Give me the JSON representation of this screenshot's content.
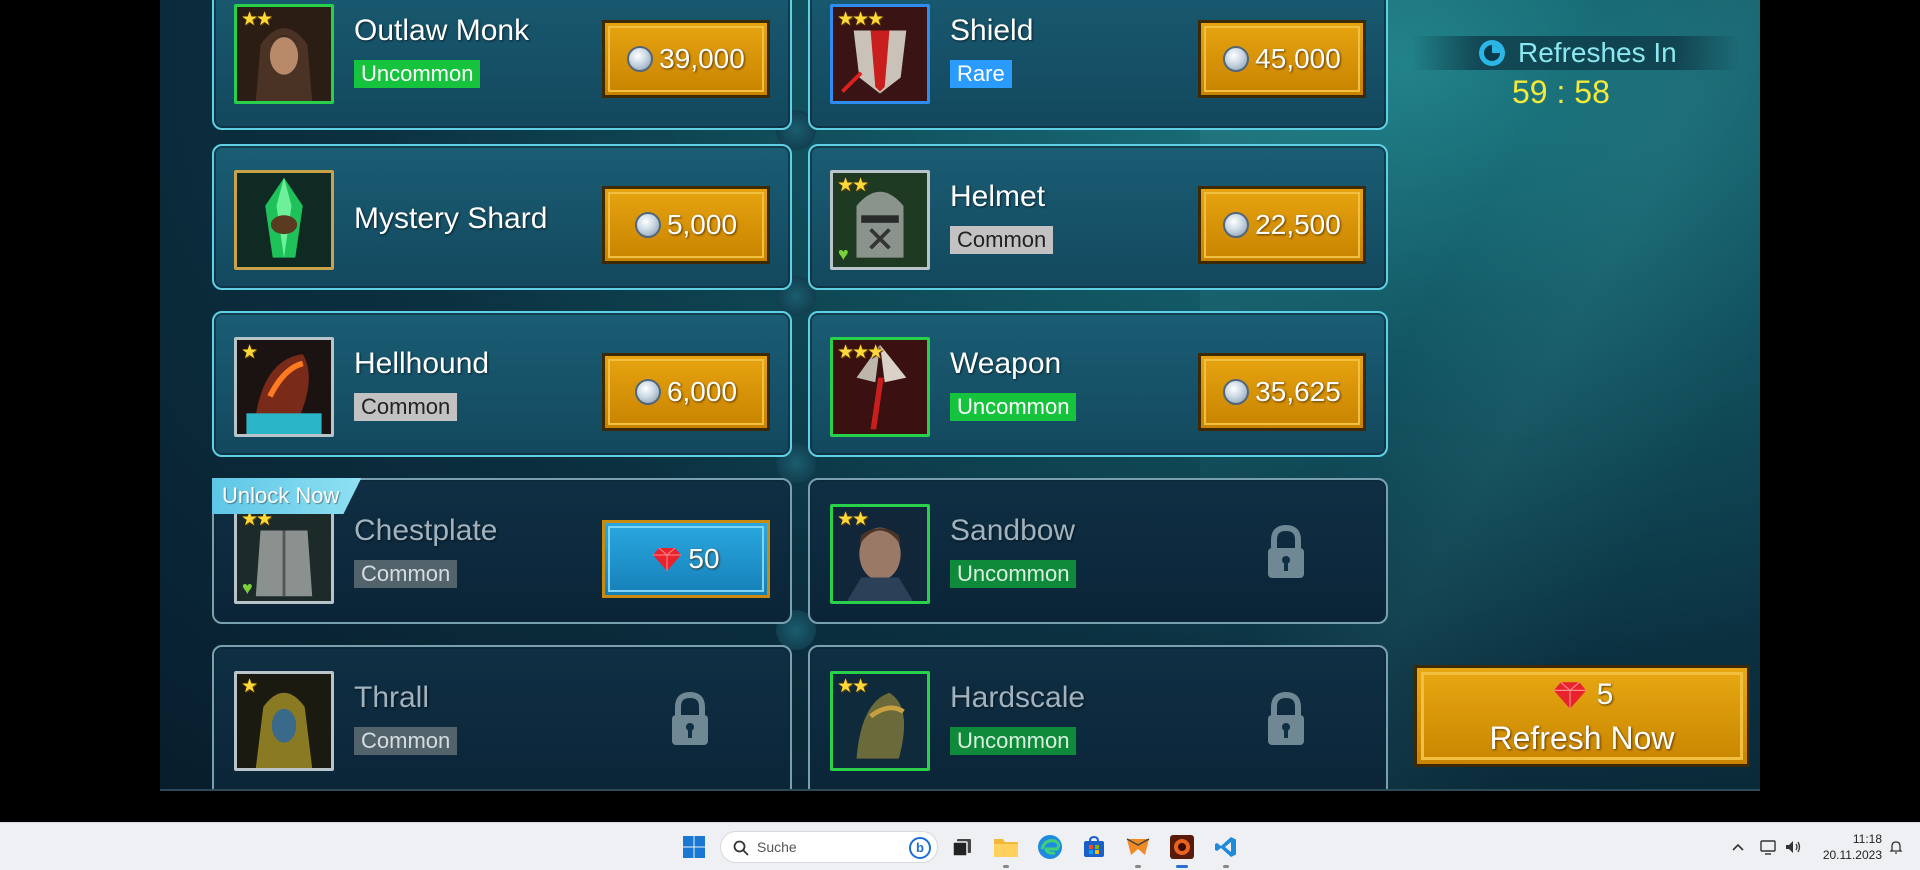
{
  "shop": {
    "slots": [
      {
        "name": "Outlaw Monk",
        "rarity": "Uncommon",
        "stars": "★★",
        "price": "39,000",
        "currency": "silver",
        "locked": false
      },
      {
        "name": "Shield",
        "rarity": "Rare",
        "stars": "★★★",
        "price": "45,000",
        "currency": "silver",
        "locked": false
      },
      {
        "name": "Mystery Shard",
        "rarity": "",
        "stars": "",
        "price": "5,000",
        "currency": "silver",
        "locked": false
      },
      {
        "name": "Helmet",
        "rarity": "Common",
        "stars": "★★",
        "price": "22,500",
        "currency": "silver",
        "locked": false
      },
      {
        "name": "Hellhound",
        "rarity": "Common",
        "stars": "★",
        "price": "6,000",
        "currency": "silver",
        "locked": false
      },
      {
        "name": "Weapon",
        "rarity": "Uncommon",
        "stars": "★★★",
        "price": "35,625",
        "currency": "silver",
        "locked": false
      },
      {
        "name": "Chestplate",
        "rarity": "Common",
        "stars": "★★",
        "price": "50",
        "currency": "gem",
        "locked": true,
        "tag": "Unlock Now"
      },
      {
        "name": "Sandbow",
        "rarity": "Uncommon",
        "stars": "★★",
        "price": "",
        "currency": "",
        "locked": true
      },
      {
        "name": "Thrall",
        "rarity": "Common",
        "stars": "★",
        "price": "",
        "currency": "",
        "locked": true
      },
      {
        "name": "Hardscale",
        "rarity": "Uncommon",
        "stars": "★★",
        "price": "",
        "currency": "",
        "locked": true
      }
    ]
  },
  "refresh": {
    "label": "Refreshes In",
    "time": "59 : 58",
    "button_cost": "5",
    "button_label": "Refresh Now"
  },
  "taskbar": {
    "search_placeholder": "Suche",
    "bing_label": "b",
    "time": "11:18",
    "date": "20.11.2023"
  },
  "colors": {
    "gold": "#e7a410",
    "silver_coin": "#c9d7e3",
    "uncommon": "#16c33c",
    "rare": "#2b9cff",
    "common": "#c2c2c2",
    "timer": "#f3e93a",
    "slot_border": "#5fd0e4"
  }
}
